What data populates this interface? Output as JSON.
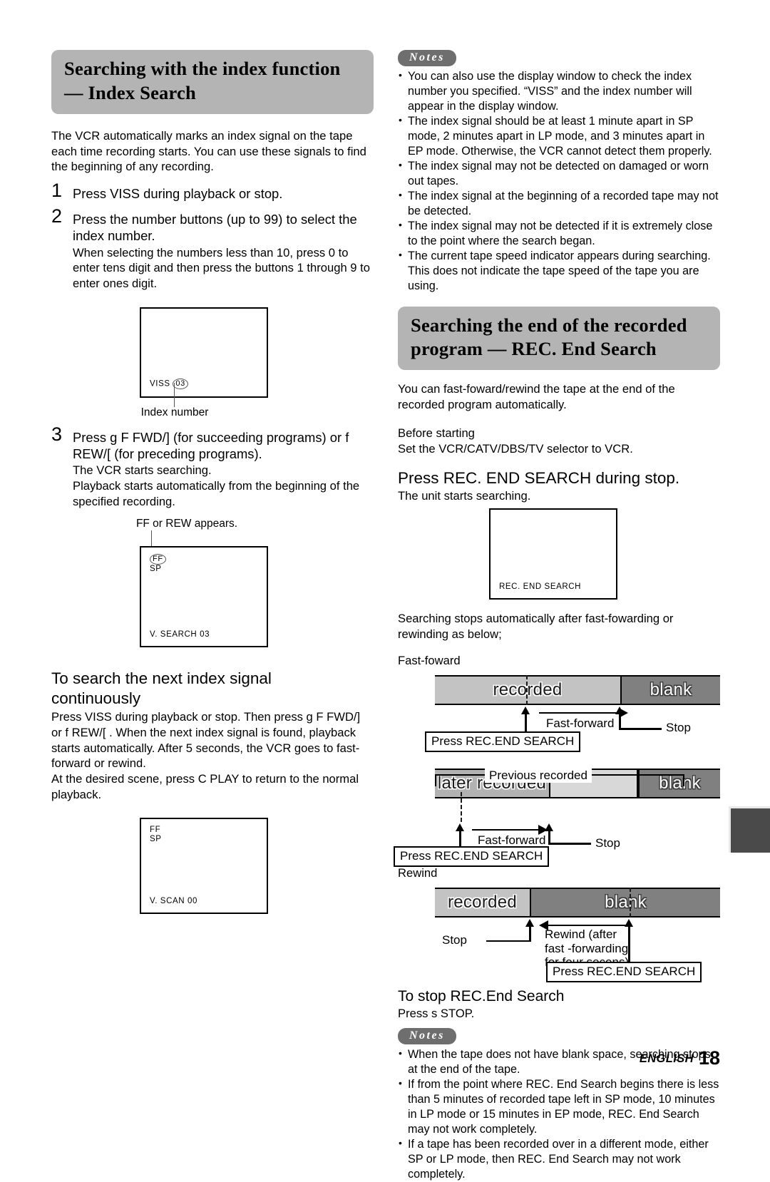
{
  "page": {
    "footer_language": "ENGLISH",
    "footer_page_number": "18",
    "colors": {
      "heading_band": "#b4b4b4",
      "notes_badge": "#6e6e6e",
      "recorded_segment": "#c3c3c3",
      "later_recorded_segment": "#b2b2b2",
      "previous_recorded_segment": "#d8d8d8",
      "blank_segment": "#808080",
      "edge_tab": "#4a4a4a"
    }
  },
  "left_column": {
    "heading": {
      "line1": "Searching with the index function",
      "line2": "— Index Search"
    },
    "intro": "The VCR automatically marks an index signal on the tape each time recording starts. You can use these signals to find the beginning of any recording.",
    "steps": [
      {
        "number": "1",
        "lead": "Press VISS during playback or stop.",
        "sub": ""
      },
      {
        "number": "2",
        "lead": "Press the number buttons (up to 99) to select the index number.",
        "sub": "When selecting the numbers less than 10, press 0 to enter tens digit and then press the buttons 1 through 9 to enter ones digit."
      },
      {
        "number": "3",
        "lead": "Press g     F FWD/]    (for succeeding programs) or   f       REW/[    (for preceding programs).",
        "sub": "The VCR starts searching.\nPlayback starts automatically from the beginning of the specified recording."
      }
    ],
    "screen_index": {
      "osd_label": "VISS",
      "osd_value": "03",
      "caption": "Index number"
    },
    "screen_search": {
      "caption_top": "FF or REW appears.",
      "osd_mode": "FF",
      "osd_speed": "SP",
      "osd_status": "V. SEARCH  03"
    },
    "continuous": {
      "heading_line1": "To search the next index signal",
      "heading_line2": "continuously",
      "body": "Press VISS during playback or stop. Then press g      F FWD/]    or f        REW/[   . When the next index signal is found, playback starts automatically. After 5 seconds, the VCR goes to fast-forward or rewind.\nAt the desired scene, press C   PLAY to return to the normal playback."
    },
    "screen_scan": {
      "osd_mode": "FF",
      "osd_speed": "SP",
      "osd_status": "V. SCAN  00"
    }
  },
  "right_column": {
    "notes_top": {
      "badge": "Notes",
      "items": [
        "You can also use the display window to check the index number you specified. “VISS” and the index number will appear in the display window.",
        "The index signal should be at least 1 minute apart in SP mode, 2 minutes apart in LP mode, and 3 minutes apart in EP mode. Otherwise, the VCR cannot detect them properly.",
        "The index signal may not be detected on damaged or worn out tapes.",
        "The index signal at the beginning of a recorded tape may not be detected.",
        "The index signal may not be detected if it is extremely close to the point where the search began.",
        "The current tape speed indicator appears during searching. This does not indicate the tape speed of the tape you are using."
      ]
    },
    "heading": {
      "line1": "Searching the end of the recorded",
      "line2": "program — REC. End Search"
    },
    "intro": "You can fast-foward/rewind the tape at the end of the recorded program automatically.",
    "before_starting_label": "Before starting",
    "before_starting_text": "Set the VCR/CATV/DBS/TV selector to VCR.",
    "action_heading": "Press REC. END SEARCH during stop.",
    "action_sub": "The unit starts searching.",
    "screen_recend": {
      "osd_status": "REC. END SEARCH"
    },
    "after_text": "Searching stops automatically after fast-fowarding or rewinding as below;",
    "diagram_ff_label": "Fast-foward",
    "diagram_rewind_label": "Rewind",
    "diagrams": [
      {
        "name": "fast-forward-simple",
        "segments": [
          {
            "label": "recorded",
            "style": "recorded"
          },
          {
            "label": "blank",
            "style": "blank"
          }
        ],
        "arrow_label": "Fast-forward",
        "stop_label": "Stop",
        "press_label": "Press REC.END SEARCH"
      },
      {
        "name": "fast-forward-overrecorded",
        "bracket_label": "Previous recorded",
        "segments": [
          {
            "label": "later recorded",
            "style": "recorded2"
          },
          {
            "label": "",
            "style": "midlight"
          },
          {
            "label": "blank",
            "style": "blank"
          }
        ],
        "arrow_label": "Fast-forward",
        "stop_label": "Stop",
        "press_label": "Press REC.END SEARCH"
      },
      {
        "name": "rewind",
        "segments": [
          {
            "label": "recorded",
            "style": "recorded"
          },
          {
            "label": "blank",
            "style": "blank"
          }
        ],
        "arrow_label_line1": "Rewind (after",
        "arrow_label_line2": "fast -forwarding",
        "arrow_label_line3": "for four secons)",
        "stop_label": "Stop",
        "press_label": "Press REC.END SEARCH"
      }
    ],
    "stop_heading": "To stop REC.End Search",
    "stop_text": "Press s   STOP.",
    "notes_bottom": {
      "badge": "Notes",
      "items": [
        "When the tape does not have blank space, searching stops at the end of the tape.",
        "If from the point where REC. End Search begins there is less than 5 minutes of recorded tape left in SP mode, 10 minutes in LP mode or 15 minutes in EP mode, REC. End Search may not work completely.",
        "If a tape has been recorded over in a different mode, either SP or LP mode, then REC. End Search may not work completely."
      ]
    }
  }
}
